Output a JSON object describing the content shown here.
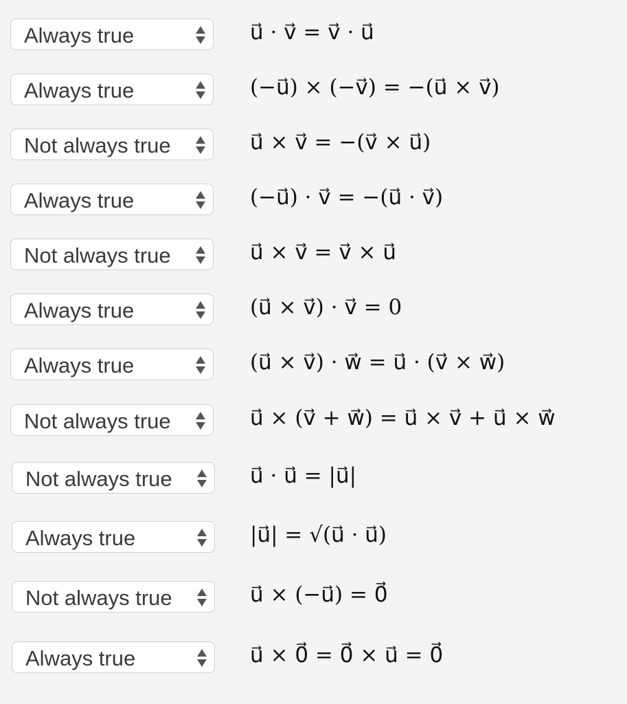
{
  "options": [
    "Always true",
    "Not always true"
  ],
  "rows": [
    {
      "answer": "Always true",
      "statement": "u⃗ · v⃗ = v⃗ · u⃗"
    },
    {
      "answer": "Always true",
      "statement": "(−u⃗) × (−v⃗) = −(u⃗ × v⃗)"
    },
    {
      "answer": "Not always true",
      "statement": "u⃗ × v⃗ = −(v⃗ × u⃗)"
    },
    {
      "answer": "Always true",
      "statement": "(−u⃗) · v⃗ = −(u⃗ · v⃗)"
    },
    {
      "answer": "Not always true",
      "statement": "u⃗ × v⃗ = v⃗ × u⃗"
    },
    {
      "answer": "Always true",
      "statement": "(u⃗ × v⃗) · v⃗ = 0"
    },
    {
      "answer": "Always true",
      "statement": "(u⃗ × v⃗) · w⃗ = u⃗ · (v⃗ × w⃗)"
    },
    {
      "answer": "Not always true",
      "statement": "u⃗ × (v⃗ + w⃗) = u⃗ × v⃗ + u⃗ × w⃗"
    },
    {
      "answer": "Not always true",
      "statement": "u⃗ · u⃗ = |u⃗|"
    },
    {
      "answer": "Always true",
      "statement": "|u⃗| = √(u⃗ · u⃗)"
    },
    {
      "answer": "Not always true",
      "statement": "u⃗ × (−u⃗) = 0⃗"
    },
    {
      "answer": "Always true",
      "statement": "u⃗ × 0⃗ = 0⃗ × u⃗ = 0⃗"
    }
  ]
}
